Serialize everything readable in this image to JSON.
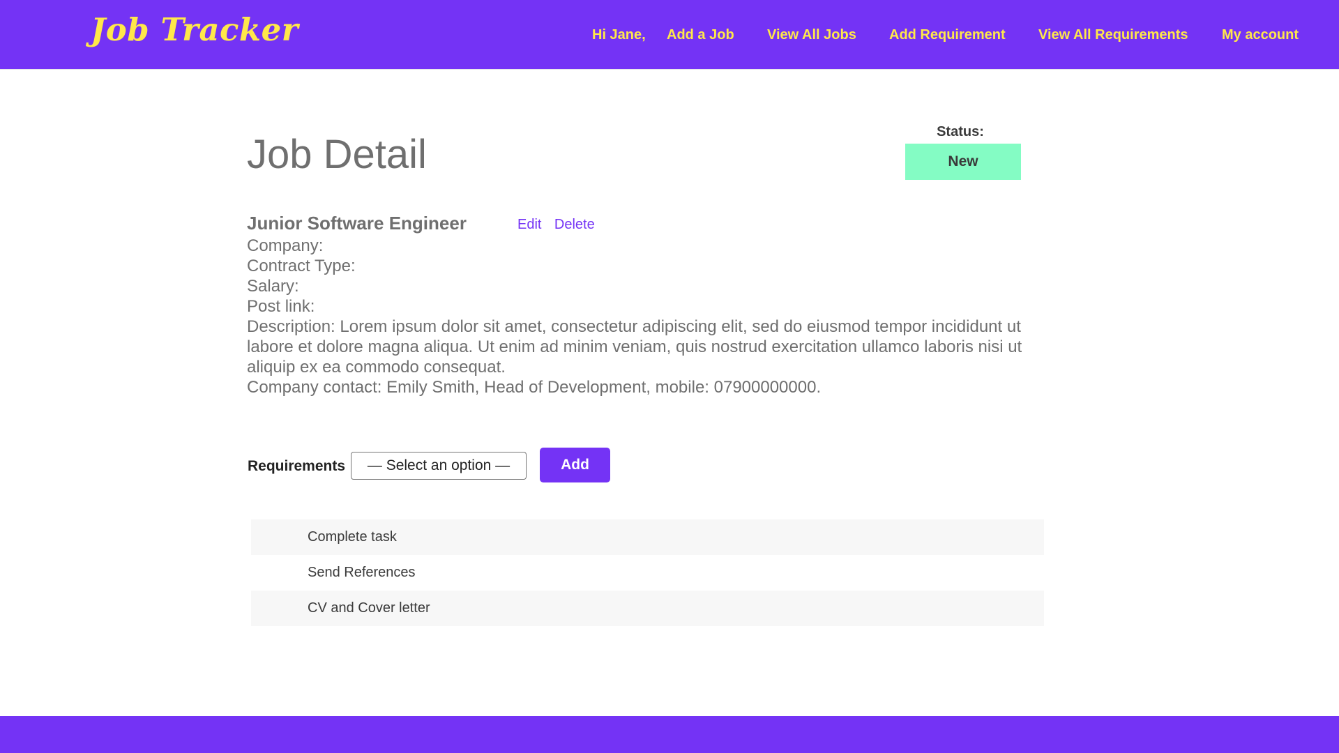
{
  "app": {
    "logo": "Job Tracker"
  },
  "nav": {
    "greeting": "Hi Jane,",
    "items": [
      {
        "label": "Add a Job"
      },
      {
        "label": "View All Jobs"
      },
      {
        "label": "Add Requirement"
      },
      {
        "label": "View All Requirements"
      },
      {
        "label": "My account"
      }
    ]
  },
  "page": {
    "title": "Job Detail"
  },
  "status": {
    "label": "Status:",
    "value": "New",
    "color": "#84fcc4"
  },
  "job": {
    "title": "Junior Software Engineer",
    "edit_label": "Edit",
    "delete_label": "Delete",
    "company": "Company:",
    "contract_type": "Contract Type:",
    "salary": "Salary:",
    "post_link": "Post link:",
    "description": "Description: Lorem ipsum dolor sit amet, consectetur adipiscing elit, sed do eiusmod tempor incididunt ut labore et dolore magna aliqua. Ut enim ad minim veniam, quis nostrud exercitation ullamco laboris nisi ut aliquip ex ea commodo consequat.",
    "contact": "Company contact: Emily Smith, Head of Development, mobile: 07900000000."
  },
  "requirements": {
    "label": "Requirements",
    "select_value": "— Select an option —",
    "add_label": "Add",
    "items": [
      {
        "label": "Complete task"
      },
      {
        "label": "Send References"
      },
      {
        "label": "CV and Cover letter"
      }
    ]
  },
  "colors": {
    "brand": "#7433f5",
    "nav_text": "#ffe84a",
    "body_text": "#6f6f6f"
  }
}
